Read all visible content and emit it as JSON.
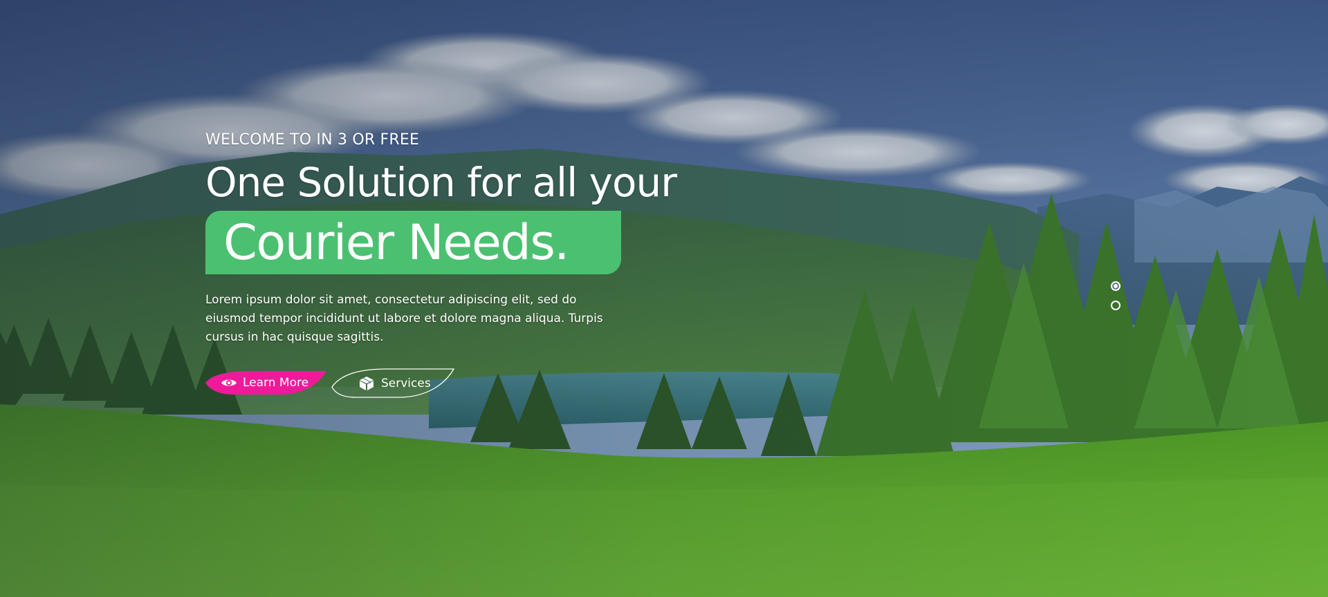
{
  "hero": {
    "eyebrow": "WELCOME TO IN 3 OR FREE",
    "headline": "One Solution for all your",
    "highlight": "Courier Needs.",
    "description": "Lorem ipsum dolor sit amet, consectetur adipiscing elit, sed do eiusmod tempor incididunt ut labore et dolore magna aliqua. Turpis cursus in hac quisque sagittis.",
    "buttons": {
      "learn_more": "Learn More",
      "services": "Services"
    }
  },
  "slider": {
    "slide_count": 2,
    "active_index": 0
  },
  "icons": {
    "learn_more": "eye-icon",
    "services": "box-icon"
  },
  "colors": {
    "accent_green": "#4cc071",
    "accent_pink": "#ee1a9a",
    "text": "#ffffff"
  }
}
